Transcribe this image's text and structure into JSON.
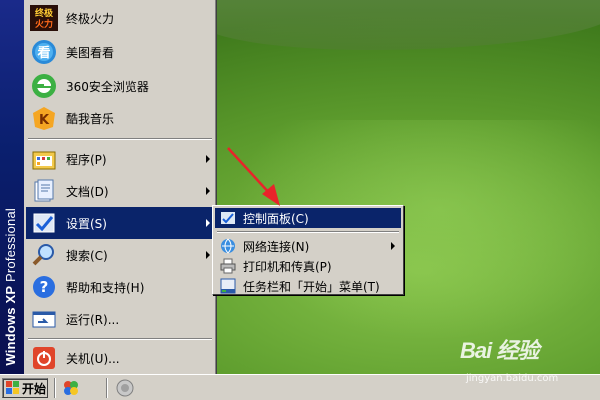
{
  "sidebar_banner": {
    "bold": "Windows XP",
    "light": " Professional"
  },
  "start_menu": {
    "pinned": [
      {
        "label": "终极火力",
        "icon": "game-logo-icon"
      },
      {
        "label": "美图看看",
        "icon": "image-viewer-icon"
      },
      {
        "label": "360安全浏览器",
        "icon": "browser-icon"
      },
      {
        "label": "酷我音乐",
        "icon": "music-player-icon"
      }
    ],
    "items": [
      {
        "label": "程序(P)",
        "icon": "programs-icon",
        "submenu": true
      },
      {
        "label": "文档(D)",
        "icon": "documents-icon",
        "submenu": true
      },
      {
        "label": "设置(S)",
        "icon": "settings-icon",
        "submenu": true,
        "highlighted": true
      },
      {
        "label": "搜索(C)",
        "icon": "search-icon",
        "submenu": true
      },
      {
        "label": "帮助和支持(H)",
        "icon": "help-icon",
        "submenu": false
      },
      {
        "label": "运行(R)...",
        "icon": "run-icon",
        "submenu": false
      },
      {
        "label": "关机(U)...",
        "icon": "shutdown-icon",
        "submenu": false
      }
    ]
  },
  "settings_submenu": {
    "items": [
      {
        "label": "控制面板(C)",
        "icon": "control-panel-icon",
        "highlighted": true
      },
      {
        "label": "网络连接(N)",
        "icon": "network-icon",
        "submenu": true
      },
      {
        "label": "打印机和传真(P)",
        "icon": "printer-icon"
      },
      {
        "label": "任务栏和「开始」菜单(T)",
        "icon": "taskbar-icon"
      }
    ]
  },
  "taskbar": {
    "start_label": "开始"
  },
  "watermark": {
    "brand": "Bai 经验",
    "url": "jingyan.baidu.com"
  },
  "colors": {
    "highlight": "#0a246a",
    "menu_bg": "#d4d0c8",
    "banner": "#0a1f6e",
    "arrow": "#e8242a"
  }
}
